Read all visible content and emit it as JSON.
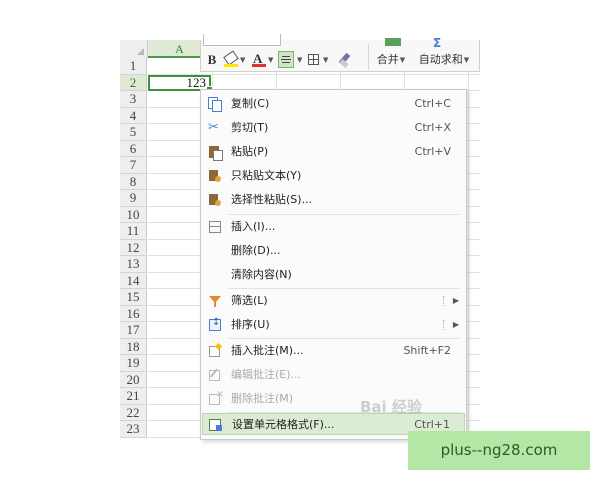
{
  "spreadsheet": {
    "columns": [
      "A"
    ],
    "row_numbers": [
      "1",
      "2",
      "3",
      "4",
      "5",
      "6",
      "7",
      "8",
      "9",
      "10",
      "11",
      "12",
      "13",
      "14",
      "15",
      "16",
      "17",
      "18",
      "19",
      "20",
      "21",
      "22",
      "23"
    ],
    "selected_row": "2",
    "active_cell_value": "123"
  },
  "mini_toolbar": {
    "bold_label": "B",
    "font_color_label": "A",
    "merge_label": "合并",
    "autosum_label": "自动求和",
    "fill_color": "#ffe600",
    "font_color": "#e03030"
  },
  "context_menu": {
    "items": [
      {
        "label": "复制(C)",
        "shortcut": "Ctrl+C",
        "icon": "copy-icon"
      },
      {
        "label": "剪切(T)",
        "shortcut": "Ctrl+X",
        "icon": "scissors-icon"
      },
      {
        "label": "粘贴(P)",
        "shortcut": "Ctrl+V",
        "icon": "paste-icon"
      },
      {
        "label": "只粘贴文本(Y)",
        "shortcut": "",
        "icon": "paste-text-icon"
      },
      {
        "label": "选择性粘贴(S)...",
        "shortcut": "",
        "icon": "paste-special-icon"
      },
      {
        "label": "插入(I)...",
        "shortcut": "",
        "icon": "insert-icon"
      },
      {
        "label": "删除(D)...",
        "shortcut": "",
        "icon": ""
      },
      {
        "label": "清除内容(N)",
        "shortcut": "",
        "icon": ""
      },
      {
        "label": "筛选(L)",
        "shortcut": "",
        "icon": "filter-icon"
      },
      {
        "label": "排序(U)",
        "shortcut": "",
        "icon": "sort-icon"
      },
      {
        "label": "插入批注(M)...",
        "shortcut": "Shift+F2",
        "icon": "comment-icon"
      },
      {
        "label": "编辑批注(E)...",
        "shortcut": "",
        "icon": "edit-comment-icon"
      },
      {
        "label": "删除批注(M)",
        "shortcut": "",
        "icon": "delete-comment-icon"
      },
      {
        "label": "设置单元格格式(F)...",
        "shortcut": "Ctrl+1",
        "icon": "format-cells-icon"
      }
    ],
    "highlight_color": "#dcebd3"
  },
  "watermarks": {
    "baidu": "Bai 经验",
    "site": "plus--ng28.com"
  }
}
